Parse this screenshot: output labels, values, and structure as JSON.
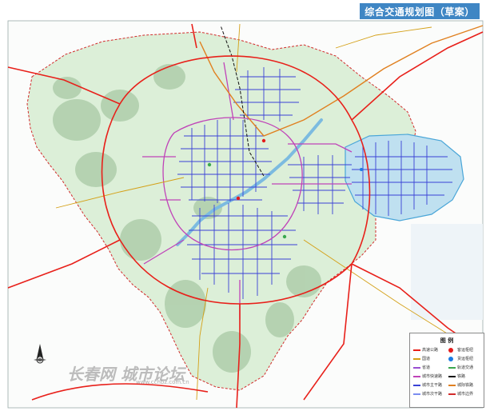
{
  "title": "综合交通规划图（草案）",
  "legend": {
    "title": "图 例",
    "items": [
      {
        "label": "高速公路",
        "color": "#e8201a"
      },
      {
        "label": "国道",
        "color": "#d4a017"
      },
      {
        "label": "省道",
        "color": "#9a4fd1"
      },
      {
        "label": "城市快速路",
        "color": "#c043b8"
      },
      {
        "label": "城市主干路",
        "color": "#3a42d6"
      },
      {
        "label": "城市次干路",
        "color": "#7b8df0"
      },
      {
        "label": "城际铁路",
        "color": "#e08020"
      },
      {
        "label": "铁路",
        "color": "#111111"
      },
      {
        "label": "轨道交通",
        "color": "#3aa84e"
      },
      {
        "label": "客运枢纽",
        "color": "#e41b1b"
      },
      {
        "label": "货运枢纽",
        "color": "#1b7ce4"
      },
      {
        "label": "城市边界",
        "color": "#d22b2b"
      }
    ]
  },
  "watermark": {
    "text": "长春网 城市论坛",
    "url": "www.cchbz.com.cn"
  },
  "colors": {
    "green_area": "#cfe8cc",
    "hill": "#9fc49d",
    "water": "#7cbbe0",
    "expressway": "#e8201a",
    "arterial": "#3a42d6",
    "express_city": "#c043b8",
    "boundary": "#d22b2b"
  },
  "icons": {
    "compass": "north-arrow-icon"
  }
}
